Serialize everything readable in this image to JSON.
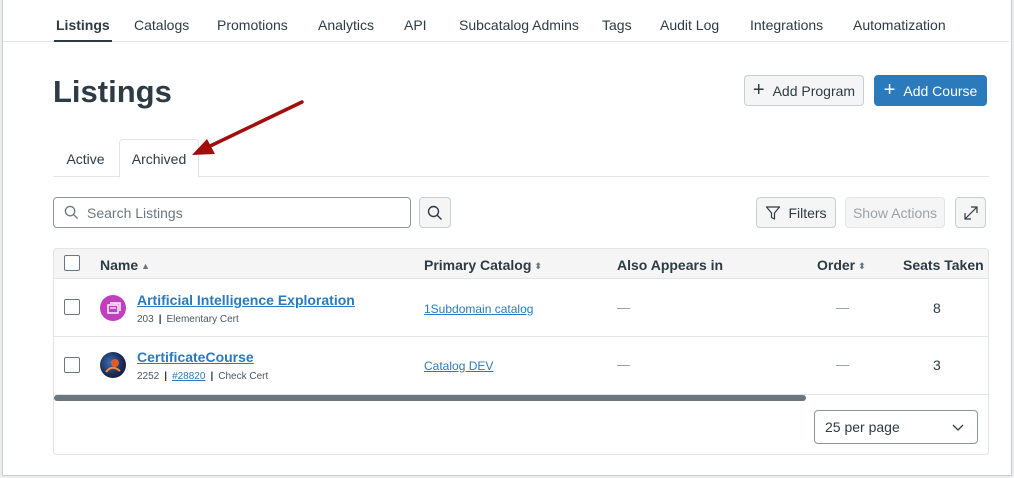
{
  "topnav": {
    "items": [
      {
        "label": "Listings",
        "active": true
      },
      {
        "label": "Catalogs"
      },
      {
        "label": "Promotions"
      },
      {
        "label": "Analytics"
      },
      {
        "label": "API"
      },
      {
        "label": "Subcatalog Admins"
      },
      {
        "label": "Tags"
      },
      {
        "label": "Audit Log"
      },
      {
        "label": "Integrations"
      },
      {
        "label": "Automatization"
      }
    ]
  },
  "page": {
    "title": "Listings"
  },
  "actions": {
    "add_program": "Add Program",
    "add_course": "Add Course"
  },
  "tabs": [
    {
      "label": "Active"
    },
    {
      "label": "Archived",
      "selected": true
    }
  ],
  "toolbar": {
    "search_placeholder": "Search Listings",
    "filters_label": "Filters",
    "show_actions_label": "Show Actions"
  },
  "table": {
    "columns": {
      "name": "Name",
      "primary_catalog": "Primary Catalog",
      "also_appears_in": "Also Appears in",
      "order": "Order",
      "seats_taken": "Seats Taken"
    },
    "rows": [
      {
        "name": "Artificial Intelligence Exploration",
        "id": "203",
        "cert": "Elementary Cert",
        "primary_catalog": "1Subdomain catalog",
        "also_appears_in": "—",
        "order": "—",
        "seats_taken": "8"
      },
      {
        "name": "CertificateCourse",
        "id": "2252",
        "ref": "#28820",
        "cert": "Check Cert",
        "primary_catalog": "Catalog DEV",
        "also_appears_in": "—",
        "order": "—",
        "seats_taken": "3"
      }
    ]
  },
  "pagination": {
    "per_page": "25 per page"
  },
  "colors": {
    "primary": "#2b7abc",
    "annotation_arrow": "#a00e0e",
    "avatar_program": "#c13fbe"
  }
}
